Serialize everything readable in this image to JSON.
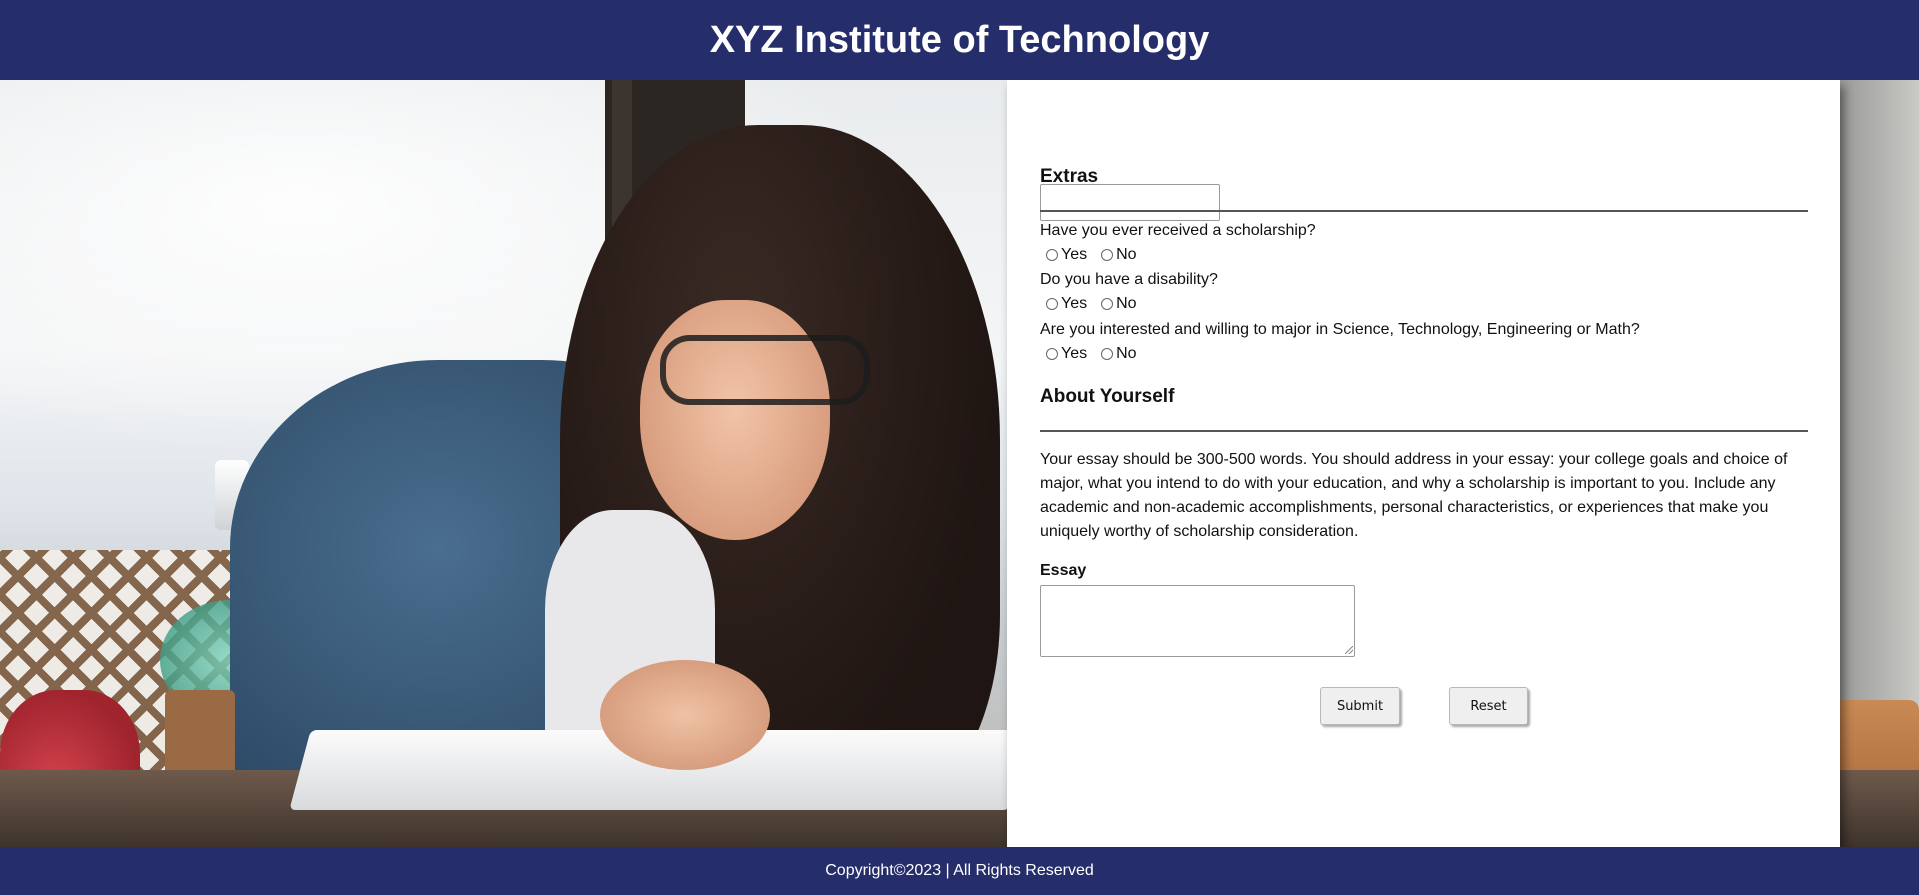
{
  "header": {
    "title": "XYZ Institute of Technology"
  },
  "form": {
    "top_input_value": "",
    "extras": {
      "title": "Extras",
      "questions": [
        {
          "text": "Have you ever received a scholarship?",
          "options": [
            "Yes",
            "No"
          ]
        },
        {
          "text": "Do you have a disability?",
          "options": [
            "Yes",
            "No"
          ]
        },
        {
          "text": "Are you interested and willing to major in Science, Technology, Engineering or Math?",
          "options": [
            "Yes",
            "No"
          ]
        }
      ]
    },
    "about": {
      "title": "About Yourself",
      "instructions": "Your essay should be 300-500 words. You should address in your essay: your college goals and choice of major, what you intend to do with your education, and why a scholarship is important to you. Include any academic and non-academic accomplishments, personal characteristics, or experiences that make you uniquely worthy of scholarship consideration.",
      "essay_label": "Essay",
      "essay_value": ""
    },
    "buttons": {
      "submit": "Submit",
      "reset": "Reset"
    }
  },
  "footer": {
    "text": "Copyright©2023 | All Rights Reserved"
  },
  "colors": {
    "header_bg": "#252d6b",
    "footer_bg": "#252d6b",
    "card_bg": "#ffffff"
  }
}
